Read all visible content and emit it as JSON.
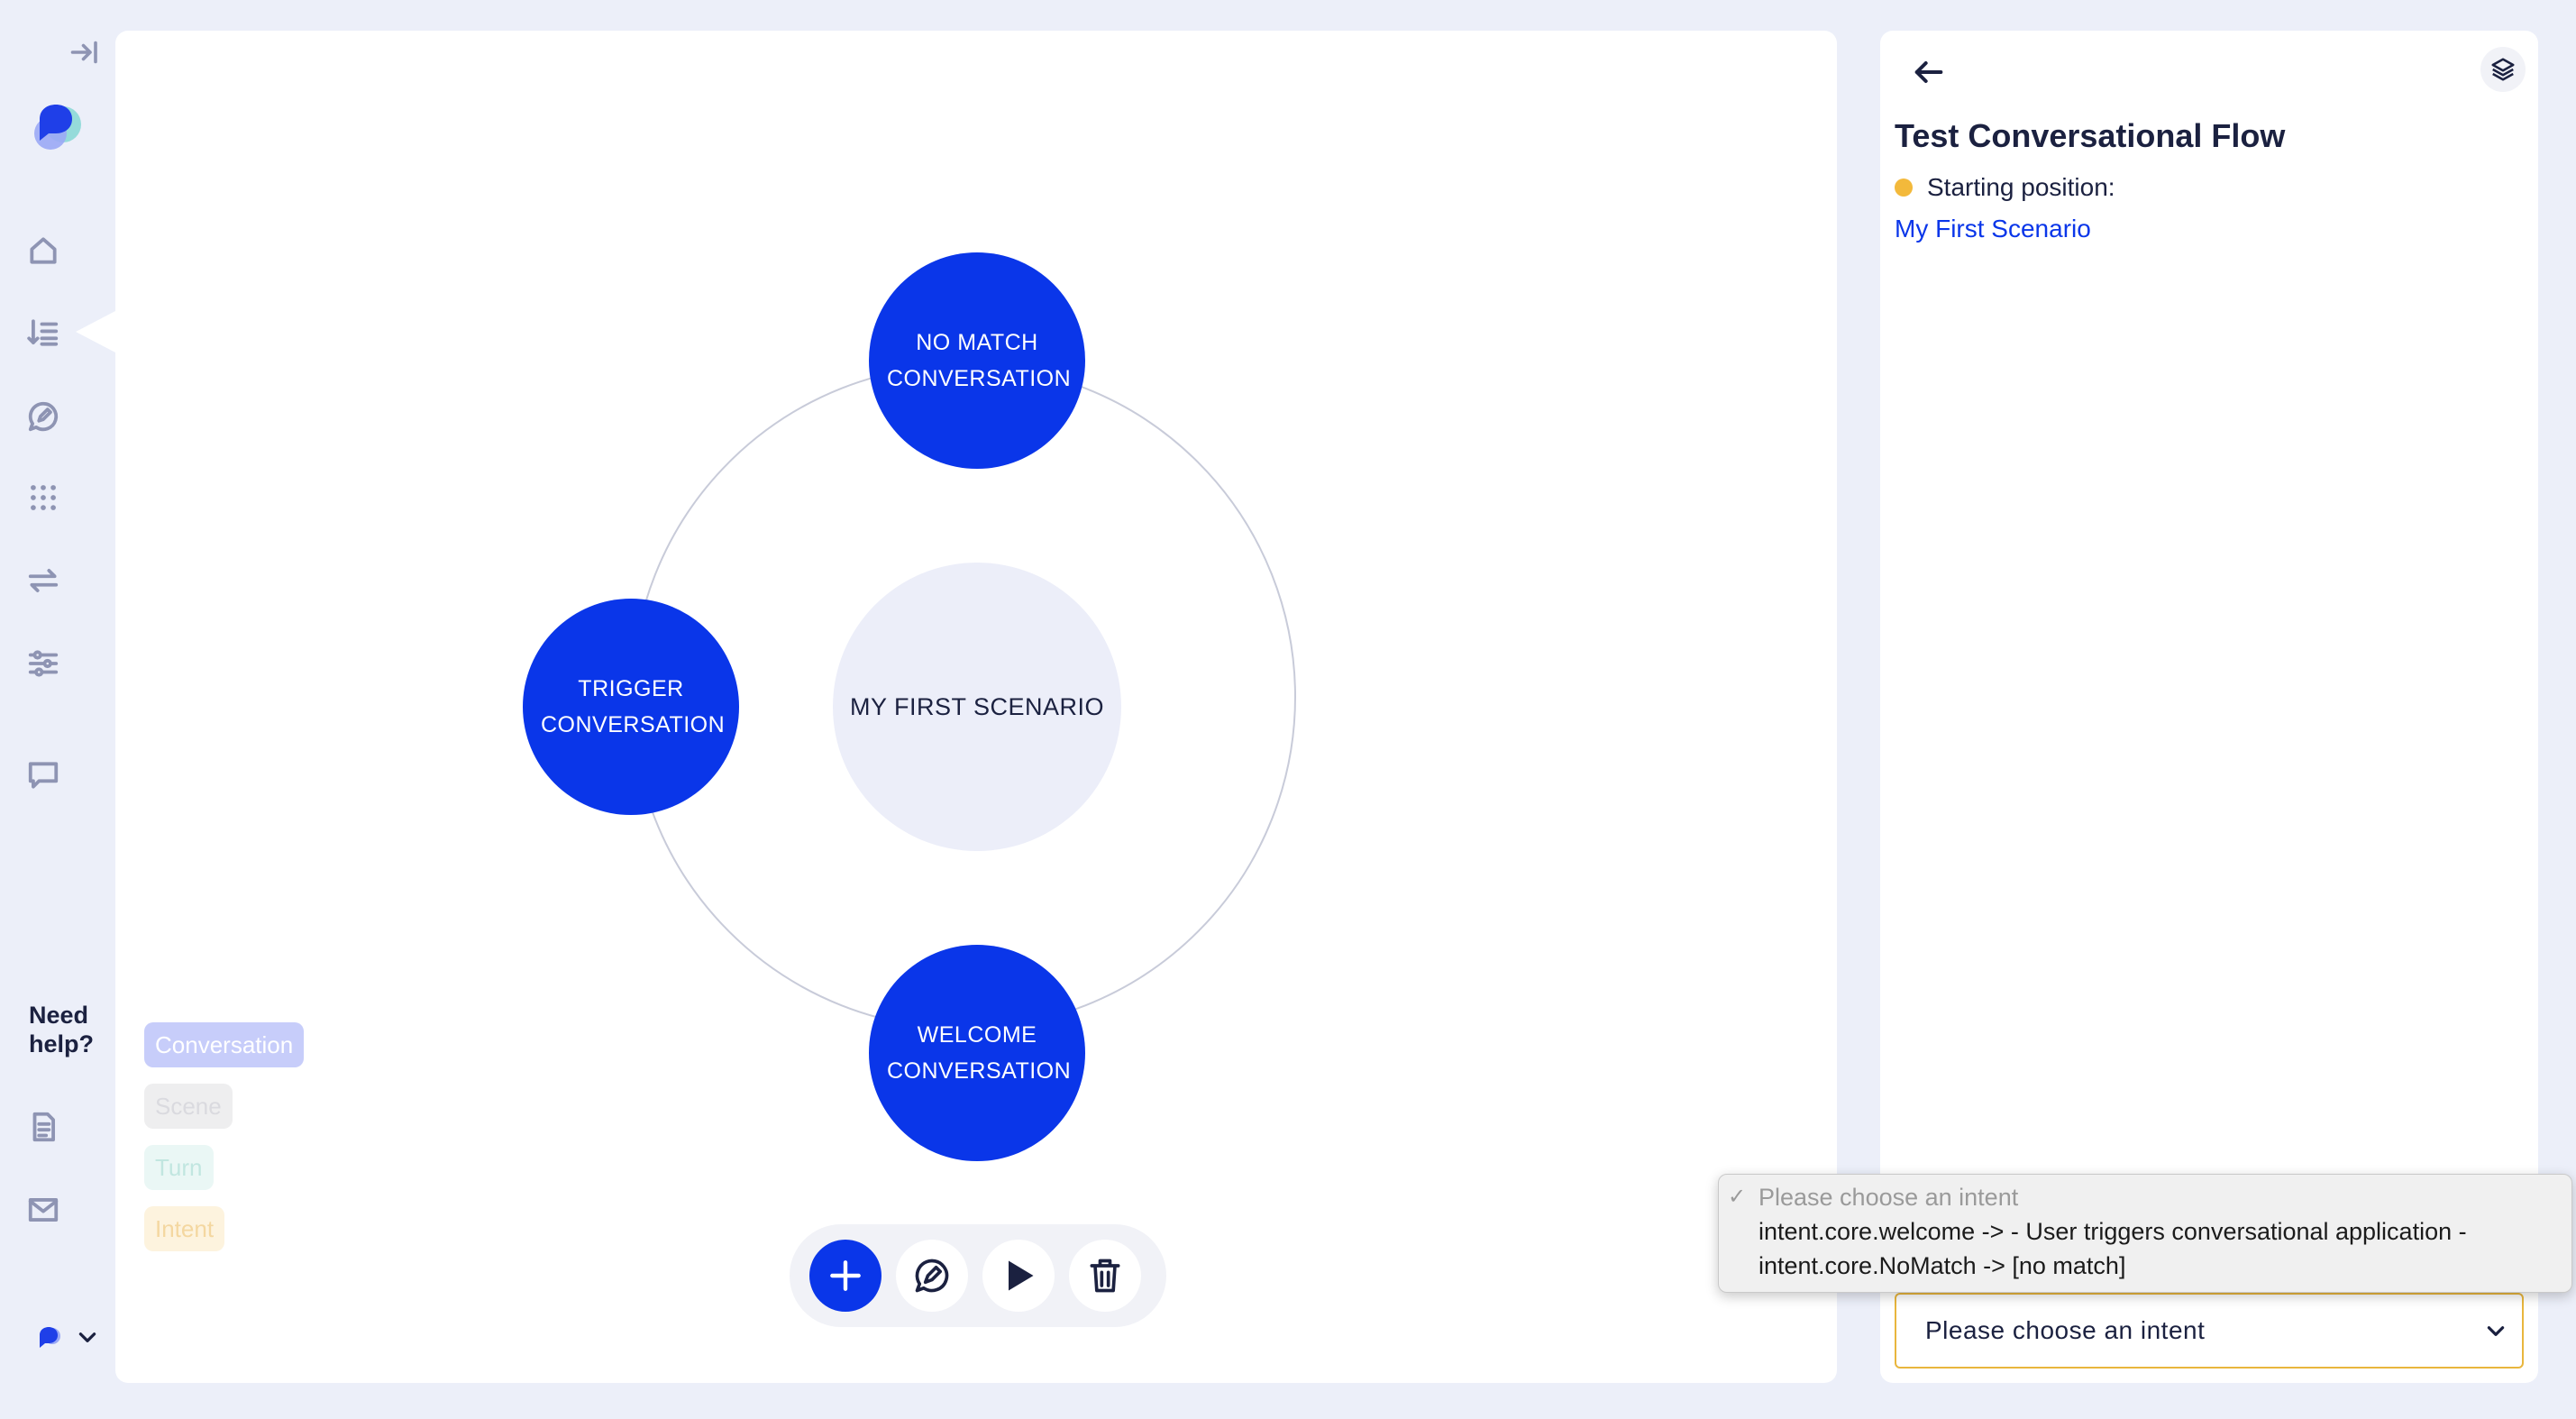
{
  "nav": {
    "collapse_icon": "collapse-sidebar-icon",
    "logo": "app-logo",
    "items": [
      {
        "icon": "home-icon"
      },
      {
        "icon": "ordered-list-icon",
        "active": true
      },
      {
        "icon": "chat-bubble-edit-icon"
      },
      {
        "icon": "grid-dots-icon"
      },
      {
        "icon": "repeat-arrows-icon"
      },
      {
        "icon": "sliders-icon"
      },
      {
        "icon": "message-icon"
      }
    ],
    "need_help_line1": "Need",
    "need_help_line2": "help?",
    "help_items": [
      {
        "icon": "document-icon"
      },
      {
        "icon": "mail-icon"
      }
    ]
  },
  "diagram": {
    "center_label": "MY FIRST SCENARIO",
    "nodes": {
      "top_line1": "NO MATCH",
      "top_line2": "CONVERSATION",
      "left_line1": "TRIGGER",
      "left_line2": "CONVERSATION",
      "bottom_line1": "WELCOME",
      "bottom_line2": "CONVERSATION"
    },
    "colors": {
      "node": "#0a36e9",
      "center": "#eceef9",
      "ring": "#c8cbd9"
    }
  },
  "legend": {
    "conversation": "Conversation",
    "scene": "Scene",
    "turn": "Turn",
    "intent": "Intent"
  },
  "toolbar": {
    "add_icon": "plus-icon",
    "edit_icon": "chat-edit-icon",
    "play_icon": "play-icon",
    "delete_icon": "trash-icon"
  },
  "panel": {
    "title": "Test Conversational Flow",
    "starting_label": "Starting position:",
    "scenario_link": "My First Scenario",
    "select_value": "Please choose an intent",
    "status_color": "#f3b93b"
  },
  "dropdown": {
    "options": [
      {
        "label": "Please choose an intent",
        "selected": true
      },
      {
        "label": "intent.core.welcome -> - User triggers conversational application -"
      },
      {
        "label": "intent.core.NoMatch -> [no match]"
      }
    ]
  }
}
